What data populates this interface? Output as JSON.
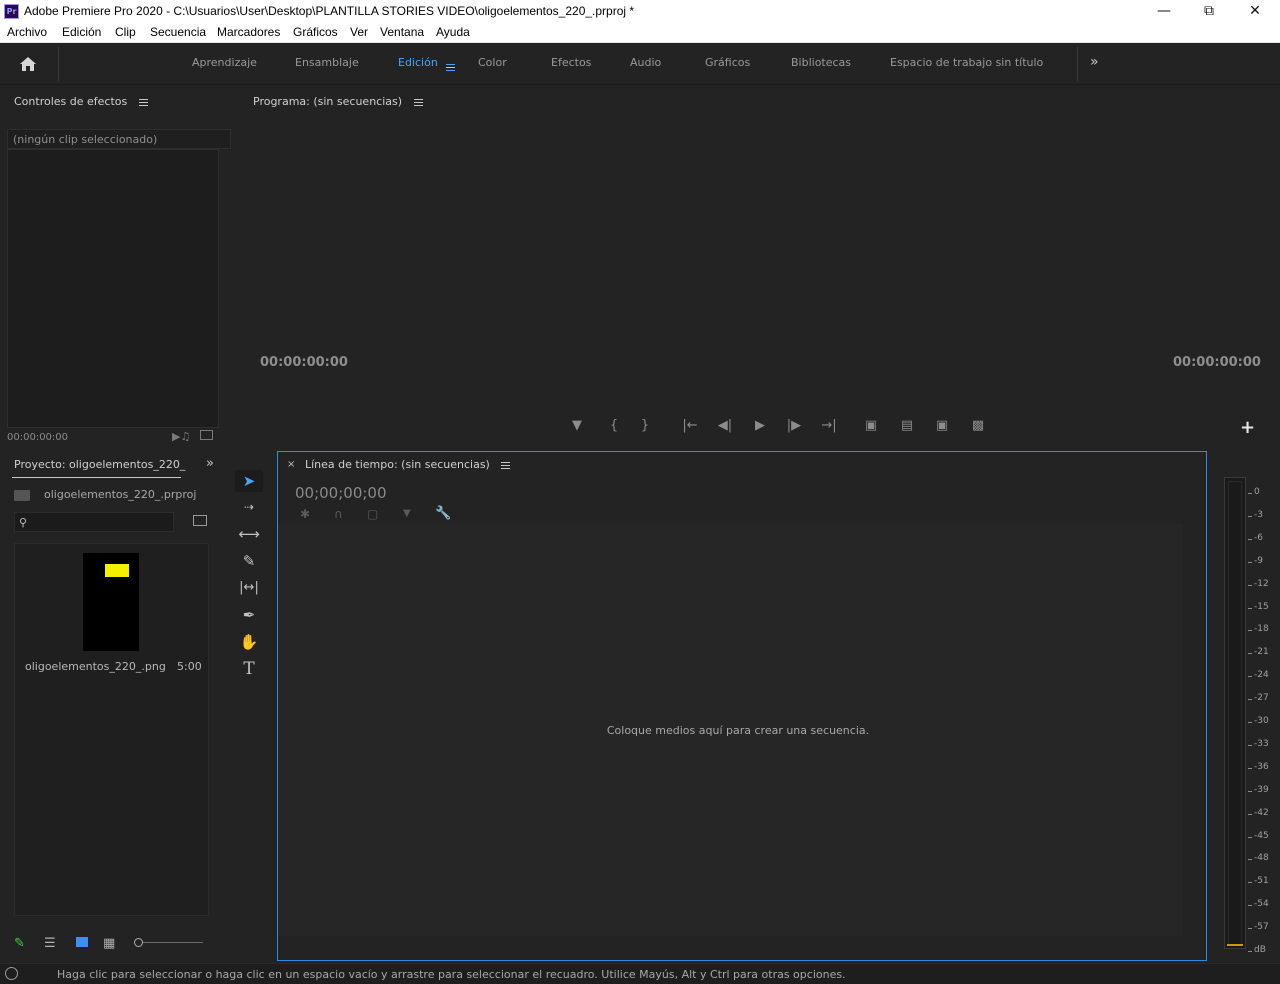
{
  "window": {
    "title": "Adobe Premiere Pro 2020 - C:\\Usuarios\\User\\Desktop\\PLANTILLA STORIES VIDEO\\oligoelementos_220_.prproj *",
    "app_icon": "Pr"
  },
  "menu": [
    "Archivo",
    "Edición",
    "Clip",
    "Secuencia",
    "Marcadores",
    "Gráficos",
    "Ver",
    "Ventana",
    "Ayuda"
  ],
  "workspaces": {
    "tabs": [
      "Aprendizaje",
      "Ensamblaje",
      "Edición",
      "Color",
      "Efectos",
      "Audio",
      "Gráficos",
      "Bibliotecas",
      "Espacio de trabajo sin título"
    ],
    "active": "Edición"
  },
  "effects_panel": {
    "title": "Controles de efectos",
    "clip_placeholder": "(ningún clip seleccionado)",
    "timecode": "00:00:00:00"
  },
  "program_monitor": {
    "title": "Programa: (sin secuencias)",
    "timecode_left": "00:00:00:00",
    "timecode_right": "00:00:00:00"
  },
  "project_panel": {
    "title": "Proyecto: oligoelementos_220_",
    "project_file": "oligoelementos_220_.prproj",
    "search_value": "",
    "items": [
      {
        "name": "oligoelementos_220_.png",
        "duration": "5:00"
      }
    ]
  },
  "timeline": {
    "title": "Línea de tiempo: (sin secuencias)",
    "timecode": "00;00;00;00",
    "drop_message": "Coloque medios aquí para crear una secuencia."
  },
  "audio_meter": {
    "labels": [
      "0",
      "-3",
      "-6",
      "-9",
      "-12",
      "-15",
      "-18",
      "-21",
      "-24",
      "-27",
      "-30",
      "-33",
      "-36",
      "-39",
      "-42",
      "-45",
      "-48",
      "-51",
      "-54",
      "-57",
      "dB"
    ]
  },
  "status_bar": {
    "message": "Haga clic para seleccionar o haga clic en un espacio vacío y arrastre para seleccionar el recuadro. Utilice Mayús, Alt y Ctrl para otras opciones."
  },
  "colors": {
    "accent": "#2d8ceb",
    "active_tab": "#4aa3f7",
    "background": "#232323"
  }
}
